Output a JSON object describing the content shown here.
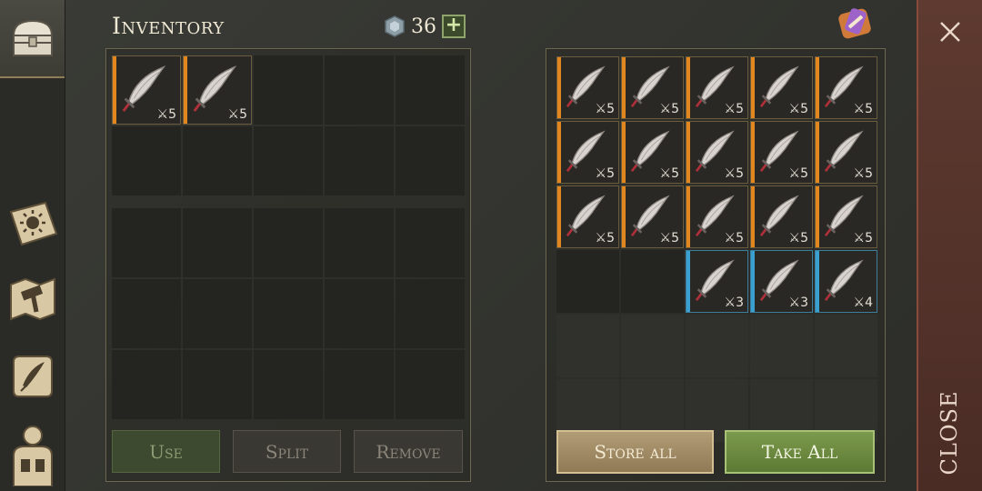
{
  "header": {
    "title": "Inventory",
    "gem_count": "36",
    "add_label": "+"
  },
  "inventory": {
    "items": [
      {
        "slot": 0,
        "name": "scimitar",
        "durability": "5",
        "rarity": "orange"
      },
      {
        "slot": 1,
        "name": "scimitar",
        "durability": "5",
        "rarity": "orange"
      }
    ]
  },
  "actions": {
    "use": "Use",
    "split": "Split",
    "remove": "Remove"
  },
  "storage": {
    "items": [
      {
        "slot": 0,
        "durability": "5",
        "rarity": "orange"
      },
      {
        "slot": 1,
        "durability": "5",
        "rarity": "orange"
      },
      {
        "slot": 2,
        "durability": "5",
        "rarity": "orange"
      },
      {
        "slot": 3,
        "durability": "5",
        "rarity": "orange"
      },
      {
        "slot": 4,
        "durability": "5",
        "rarity": "orange"
      },
      {
        "slot": 5,
        "durability": "5",
        "rarity": "orange"
      },
      {
        "slot": 6,
        "durability": "5",
        "rarity": "orange"
      },
      {
        "slot": 7,
        "durability": "5",
        "rarity": "orange"
      },
      {
        "slot": 8,
        "durability": "5",
        "rarity": "orange"
      },
      {
        "slot": 9,
        "durability": "5",
        "rarity": "orange"
      },
      {
        "slot": 10,
        "durability": "5",
        "rarity": "orange"
      },
      {
        "slot": 11,
        "durability": "5",
        "rarity": "orange"
      },
      {
        "slot": 12,
        "durability": "5",
        "rarity": "orange"
      },
      {
        "slot": 13,
        "durability": "5",
        "rarity": "orange"
      },
      {
        "slot": 14,
        "durability": "5",
        "rarity": "orange"
      },
      {
        "slot": 17,
        "durability": "3",
        "rarity": "blue"
      },
      {
        "slot": 18,
        "durability": "3",
        "rarity": "blue"
      },
      {
        "slot": 19,
        "durability": "4",
        "rarity": "blue"
      }
    ],
    "store_all": "Store all",
    "take_all": "Take All"
  },
  "close": {
    "label": "CLOSE"
  },
  "sidebar": {
    "tabs": [
      "chest-icon",
      "sun-book-icon",
      "crafting-map-icon",
      "scroll-icon",
      "character-icon"
    ]
  },
  "colors": {
    "orange_rarity": "#e2861f",
    "blue_rarity": "#3aa0d0",
    "take_all_green": "#6b8a3f",
    "store_all_tan": "#a08a64"
  }
}
